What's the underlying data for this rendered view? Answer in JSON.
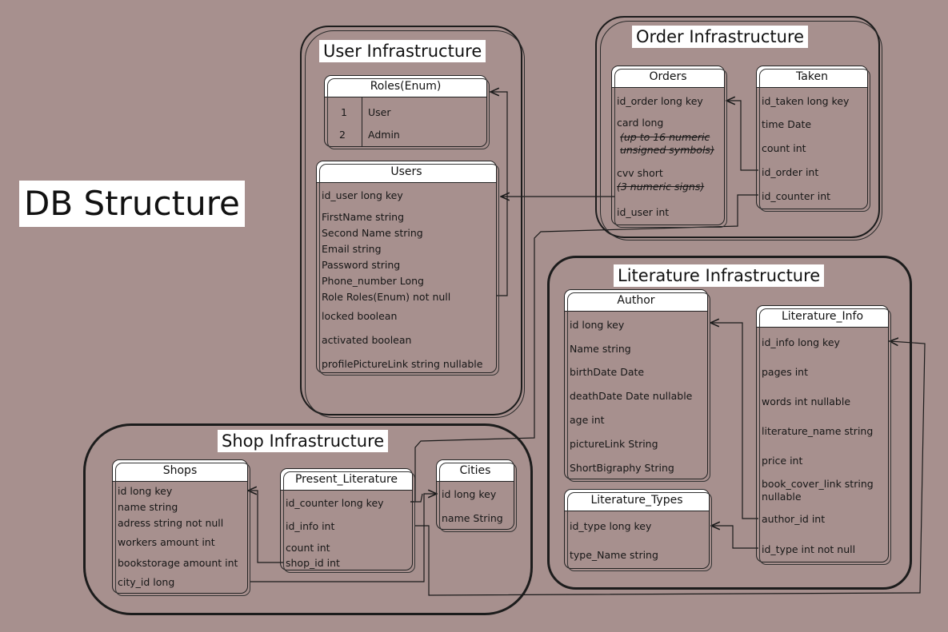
{
  "page_title": "DB Structure",
  "groups": {
    "user": "User Infrastructure",
    "order": "Order Infrastructure",
    "literature": "Literature Infrastructure",
    "shop": "Shop Infrastructure"
  },
  "tables": {
    "roles": {
      "title": "Roles(Enum)",
      "rows": [
        {
          "num": "1",
          "label": "User"
        },
        {
          "num": "2",
          "label": "Admin"
        }
      ]
    },
    "users": {
      "title": "Users",
      "fields": [
        "id_user long key",
        "FirstName string",
        "Second Name string",
        "Email string",
        "Password string",
        "Phone_number  Long",
        "Role Roles(Enum) not null",
        "locked boolean",
        "activated boolean",
        "profilePictureLink string nullable"
      ]
    },
    "orders": {
      "title": "Orders",
      "fields": [
        "id_order long key",
        "card long",
        "(up to 16 numeric",
        "unsigned symbols)",
        "cvv short",
        "(3 numeric signs)",
        "id_user int"
      ]
    },
    "taken": {
      "title": "Taken",
      "fields": [
        "id_taken long key",
        "time Date",
        "count int",
        "id_order int",
        "id_counter int"
      ]
    },
    "author": {
      "title": "Author",
      "fields": [
        "id long key",
        "Name string",
        "birthDate Date",
        "deathDate Date nullable",
        "age int",
        "pictureLink String",
        "ShortBigraphy String"
      ]
    },
    "literature_info": {
      "title": "Literature_Info",
      "fields": [
        "id_info long key",
        "pages int",
        "words int nullable",
        "literature_name string",
        "price int",
        "book_cover_link string",
        "nullable",
        "author_id int",
        "id_type int not null"
      ]
    },
    "literature_types": {
      "title": "Literature_Types",
      "fields": [
        "id_type long key",
        "type_Name string"
      ]
    },
    "shops": {
      "title": "Shops",
      "fields": [
        "id long key",
        "name string",
        "adress string not null",
        "workers amount int",
        "bookstorage amount int",
        "city_id long"
      ]
    },
    "present_literature": {
      "title": "Present_Literature",
      "fields": [
        "id_counter long key",
        "id_info int",
        "count int",
        "shop_id int"
      ]
    },
    "cities": {
      "title": "Cities",
      "fields": [
        "id long key",
        "name String"
      ]
    }
  }
}
